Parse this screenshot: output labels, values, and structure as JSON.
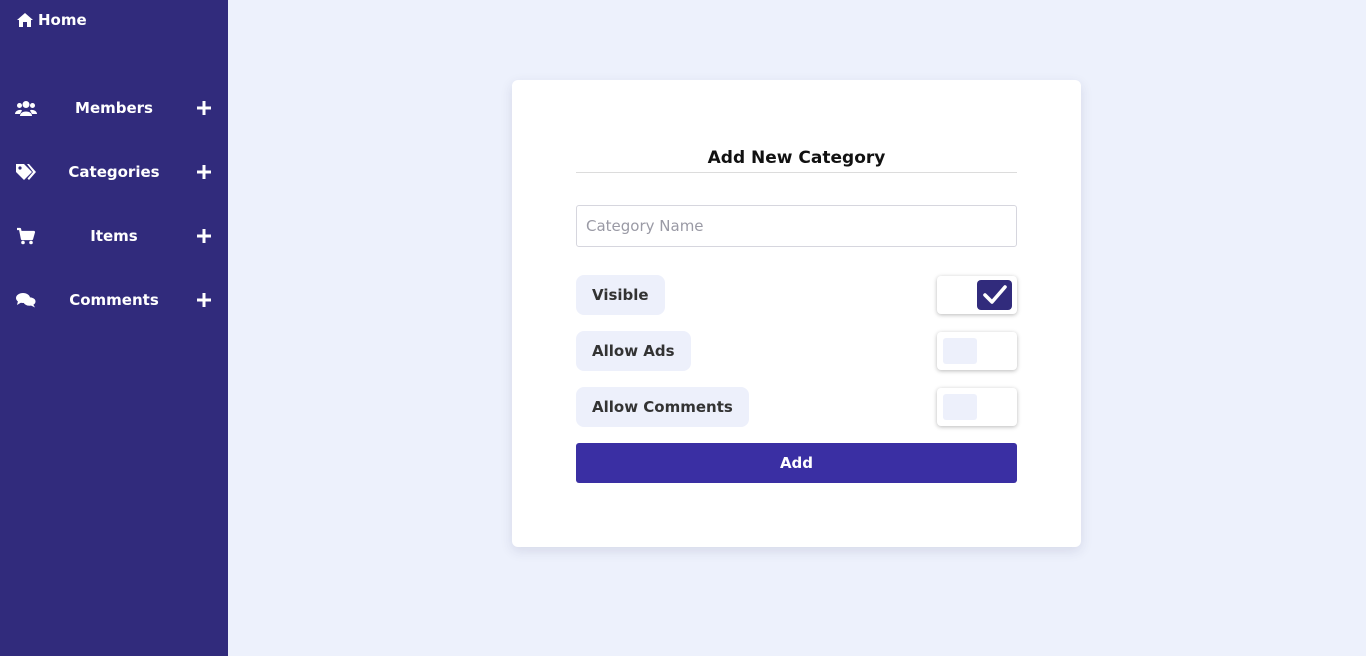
{
  "sidebar": {
    "home": {
      "label": "Home",
      "icon": "home-icon"
    },
    "items": [
      {
        "label": "Members",
        "icon": "users-icon"
      },
      {
        "label": "Categories",
        "icon": "tags-icon"
      },
      {
        "label": "Items",
        "icon": "cart-icon"
      },
      {
        "label": "Comments",
        "icon": "comments-icon"
      }
    ]
  },
  "form": {
    "title": "Add New Category",
    "name_placeholder": "Category Name",
    "name_value": "",
    "options": [
      {
        "label": "Visible",
        "checked": true
      },
      {
        "label": "Allow Ads",
        "checked": false
      },
      {
        "label": "Allow Comments",
        "checked": false
      }
    ],
    "submit_label": "Add"
  },
  "colors": {
    "sidebar_bg": "#312b7c",
    "page_bg": "#edf1fc",
    "accent": "#3a2fa3",
    "label_bg": "#edf0fb"
  }
}
